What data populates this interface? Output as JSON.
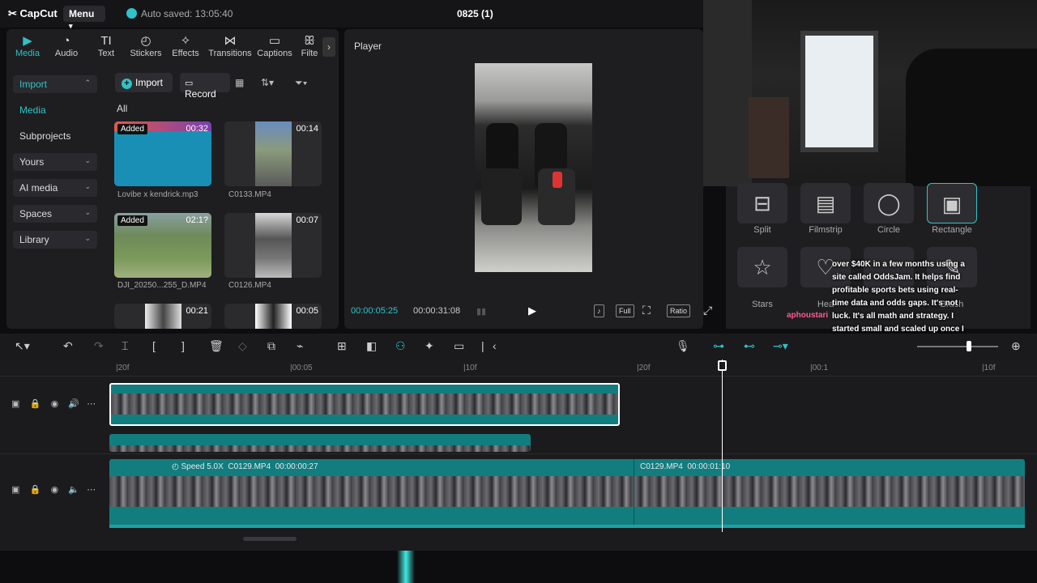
{
  "topbar": {
    "logo": "CapCut",
    "menu": "Menu",
    "autosave": "Auto saved: 13:05:40",
    "project": "0825 (1)"
  },
  "tabs": [
    {
      "label": "Media",
      "icon": "▶"
    },
    {
      "label": "Audio",
      "icon": "◔"
    },
    {
      "label": "Text",
      "icon": "TI"
    },
    {
      "label": "Stickers",
      "icon": "◴"
    },
    {
      "label": "Effects",
      "icon": "✧"
    },
    {
      "label": "Transitions",
      "icon": "⋈"
    },
    {
      "label": "Captions",
      "icon": "▭"
    },
    {
      "label": "Filte",
      "icon": "ꕥ"
    }
  ],
  "sidebar": {
    "import": "Import",
    "media": "Media",
    "subprojects": "Subprojects",
    "yours": "Yours",
    "ai_media": "AI media",
    "spaces": "Spaces",
    "library": "Library"
  },
  "media": {
    "import_btn": "Import",
    "record_btn": "Record",
    "all": "All",
    "items": [
      {
        "name": "Lovibe x kendrick.mp3",
        "duration": "00:32",
        "added": "Added"
      },
      {
        "name": "C0133.MP4",
        "duration": "00:14"
      },
      {
        "name": "DJI_20250...255_D.MP4",
        "duration": "02:1?",
        "added": "Added"
      },
      {
        "name": "C0126.MP4",
        "duration": "00:07"
      },
      {
        "name": "",
        "duration": "00:21"
      },
      {
        "name": "",
        "duration": "00:05"
      }
    ]
  },
  "player": {
    "title": "Player",
    "current": "00:00:05:25",
    "total": "00:00:31:08",
    "full": "Full",
    "ratio": "Ratio"
  },
  "layouts": [
    {
      "label": "Split"
    },
    {
      "label": "Filmstrip"
    },
    {
      "label": "Circle"
    },
    {
      "label": "Rectangle"
    },
    {
      "label": "Stars"
    },
    {
      "label": "Hea"
    },
    {
      "label": ""
    },
    {
      "label": "Brush"
    }
  ],
  "overlay": {
    "text": "over $40K in a few months using a site called OddsJam. It helps find profitable sports bets using real-time data and odds gaps. It's not luck. It's all math and strategy. I started small and scaled up once I got the hang of it. If you are interested, message me on Discord at emmakilla and I'll walk you through how it works.",
    "name1": "aphoustari",
    "name2": "aphoustari"
  },
  "timeline": {
    "ruler": [
      "|20f",
      "|00:05",
      "|10f",
      "|20f",
      "|00:1",
      "|10f"
    ],
    "clip1_speed": "Speed 5.0X",
    "clip1_name": "C0129.MP4",
    "clip1_time": "00:00:00:27",
    "clip2_name": "C0129.MP4",
    "clip2_time": "00:00:01:10"
  }
}
